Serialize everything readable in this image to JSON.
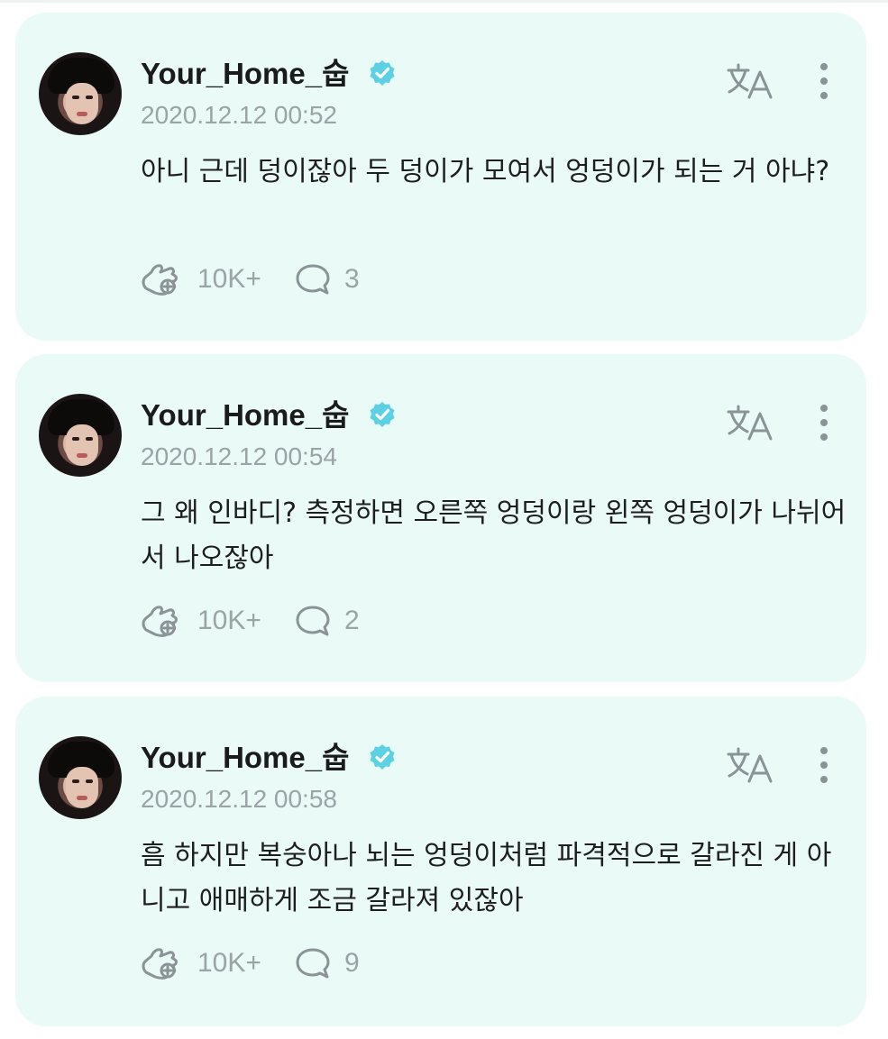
{
  "colors": {
    "card_bg": "#eafaf6",
    "verified": "#5dd1e4",
    "muted": "#9aa3a6",
    "text": "#1e1e1e"
  },
  "posts": [
    {
      "username": "Your_Home_숩",
      "verified_icon": "verified-badge-icon",
      "timestamp": "2020.12.12 00:52",
      "text": "아니 근데 덩이잖아 두 덩이가 모여서 엉덩이가 되는 거 아냐?",
      "likes": "10K+",
      "comments": "3"
    },
    {
      "username": "Your_Home_숩",
      "verified_icon": "verified-badge-icon",
      "timestamp": "2020.12.12 00:54",
      "text": "그 왜 인바디? 측정하면 오른쪽 엉덩이랑 왼쪽 엉덩이가 나뉘어서 나오잖아",
      "likes": "10K+",
      "comments": "2"
    },
    {
      "username": "Your_Home_숩",
      "verified_icon": "verified-badge-icon",
      "timestamp": "2020.12.12 00:58",
      "text": "흠 하지만 복숭아나 뇌는 엉덩이처럼 파격적으로 갈라진 게 아니고 애매하게 조금 갈라져 있잖아",
      "likes": "10K+",
      "comments": "9"
    }
  ]
}
